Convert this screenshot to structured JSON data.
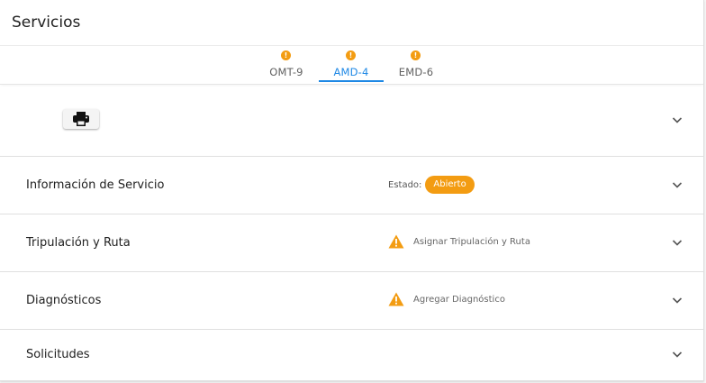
{
  "header": {
    "title": "Servicios"
  },
  "tabs": [
    {
      "label": "OMT-9",
      "badge": "!"
    },
    {
      "label": "AMD-4",
      "badge": "!"
    },
    {
      "label": "EMD-6",
      "badge": "!"
    }
  ],
  "active_tab": "AMD-4",
  "sections": {
    "info": {
      "title": "Información de Servicio",
      "status_label": "Estado:",
      "status_value": "Abierto"
    },
    "crew": {
      "title": "Tripulación y Ruta",
      "warning": "Asignar Tripulación y Ruta"
    },
    "diag": {
      "title": "Diagnósticos",
      "warning": "Agregar Diagnóstico"
    },
    "requests": {
      "title": "Solicitudes"
    }
  },
  "colors": {
    "accent": "#1e88e5",
    "warning": "#f39c12"
  },
  "icons": {
    "print": "printer-icon",
    "expand": "chevron-down-icon",
    "warning": "warning-triangle-icon",
    "tab_badge": "exclamation-badge-icon"
  }
}
